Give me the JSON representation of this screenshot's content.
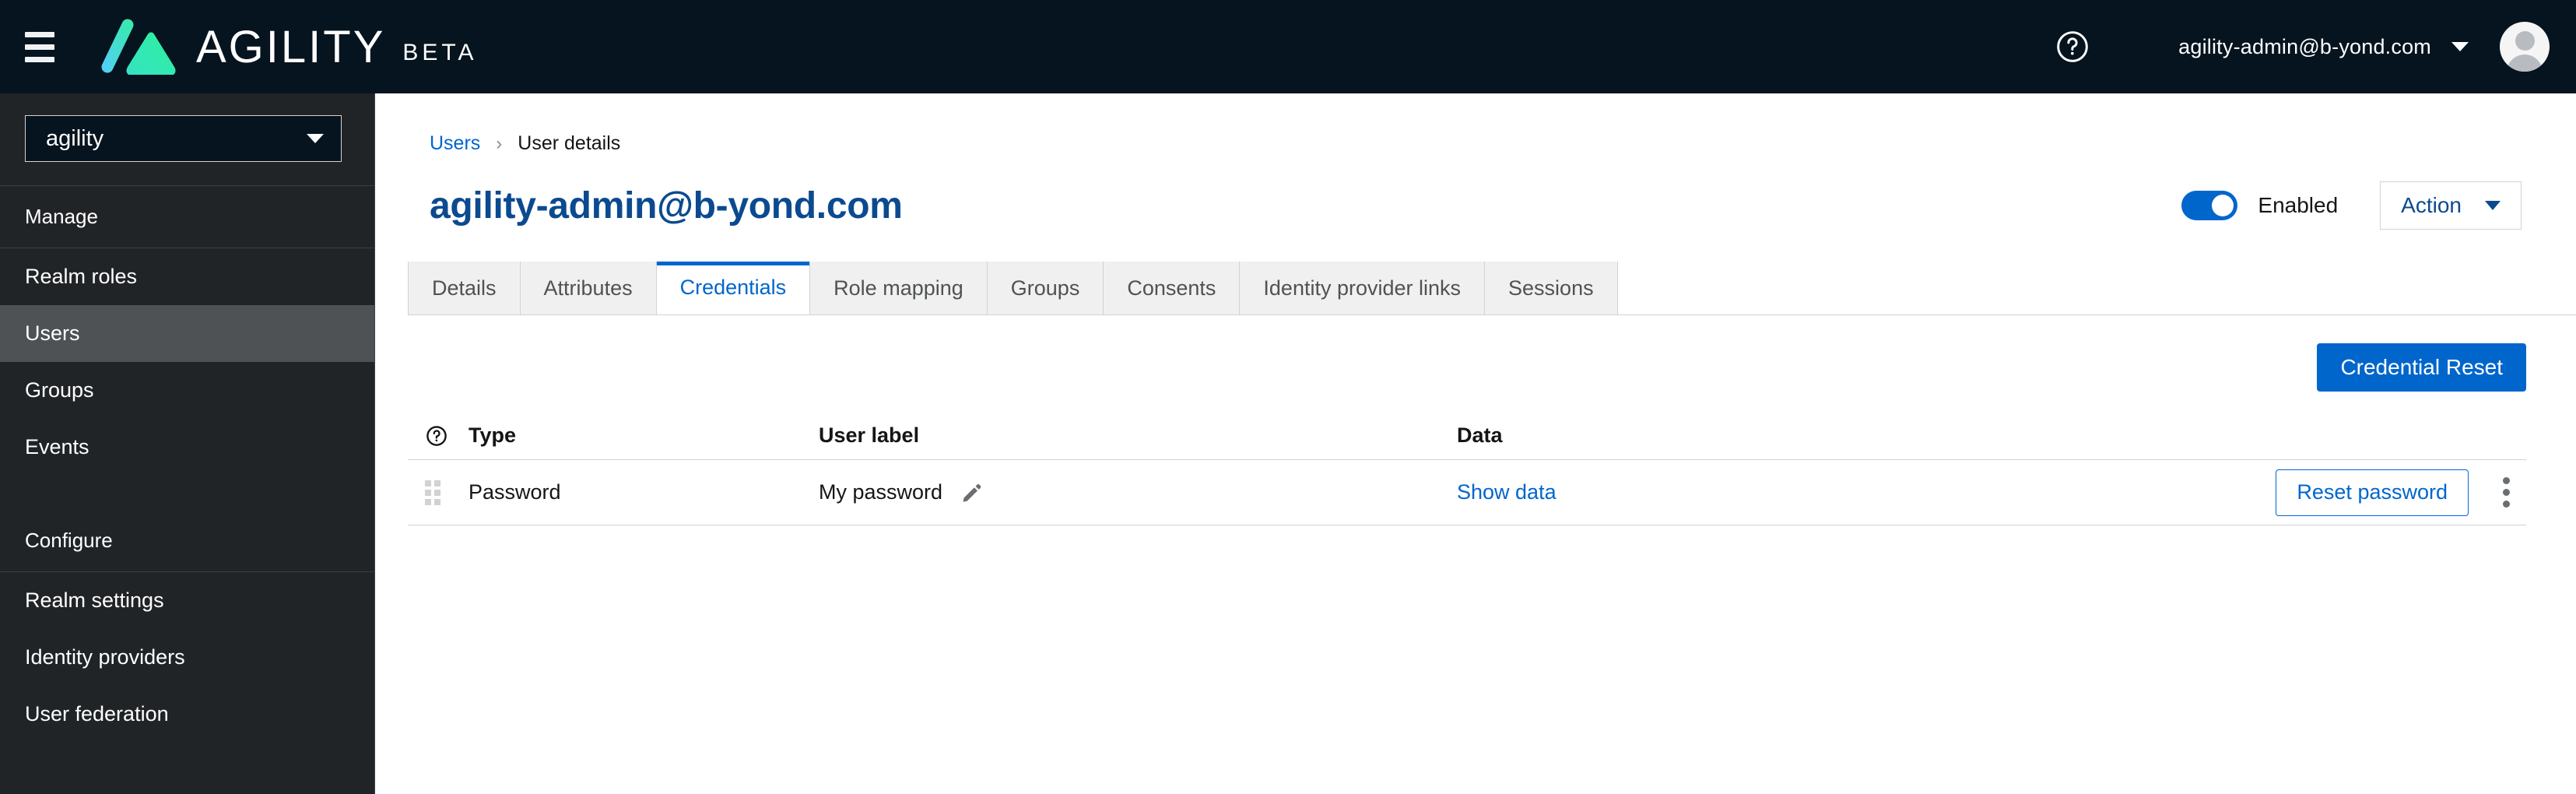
{
  "masthead": {
    "menu_icon": "hamburger-icon",
    "logo_icon": "agility-triangle-logo",
    "brand_name": "AGILITY",
    "brand_tag": "BETA",
    "help_icon": "help-circle-icon",
    "user_email": "agility-admin@b-yond.com",
    "caret_icon": "chevron-down-icon",
    "avatar_icon": "user-avatar-icon",
    "bg_color": "#06141f"
  },
  "sidebar": {
    "realm": {
      "value": "agility",
      "caret_icon": "chevron-down-icon"
    },
    "groups": [
      {
        "header": "Manage",
        "items": [
          {
            "label": "Realm roles",
            "active": false
          },
          {
            "label": "Users",
            "active": true
          },
          {
            "label": "Groups",
            "active": false
          },
          {
            "label": "Events",
            "active": false
          }
        ]
      },
      {
        "header": "Configure",
        "items": [
          {
            "label": "Realm settings",
            "active": false
          },
          {
            "label": "Identity providers",
            "active": false
          },
          {
            "label": "User federation",
            "active": false
          }
        ]
      }
    ],
    "bg_color": "#212427",
    "active_color": "#4f5255"
  },
  "breadcrumb": {
    "link": "Users",
    "separator": "›",
    "current": "User details"
  },
  "page": {
    "title": "agility-admin@b-yond.com",
    "title_color": "#0b4a8f",
    "toggle": {
      "enabled": true,
      "label": "Enabled",
      "on_color": "#0066cc"
    },
    "action_button": {
      "label": "Action",
      "caret_icon": "chevron-down-icon"
    }
  },
  "tabs": [
    {
      "label": "Details",
      "active": false
    },
    {
      "label": "Attributes",
      "active": false
    },
    {
      "label": "Credentials",
      "active": true
    },
    {
      "label": "Role mapping",
      "active": false
    },
    {
      "label": "Groups",
      "active": false
    },
    {
      "label": "Consents",
      "active": false
    },
    {
      "label": "Identity provider links",
      "active": false
    },
    {
      "label": "Sessions",
      "active": false
    }
  ],
  "toolbar": {
    "credential_reset_label": "Credential Reset",
    "primary_color": "#0066cc"
  },
  "table": {
    "help_icon": "help-circle-icon",
    "columns": {
      "type": "Type",
      "user_label": "User label",
      "data": "Data"
    },
    "rows": [
      {
        "drag_icon": "drag-grip-icon",
        "type": "Password",
        "user_label": "My password",
        "edit_icon": "pencil-edit-icon",
        "data_link": "Show data",
        "reset_button": "Reset password",
        "kebab_icon": "kebab-menu-icon"
      }
    ]
  }
}
